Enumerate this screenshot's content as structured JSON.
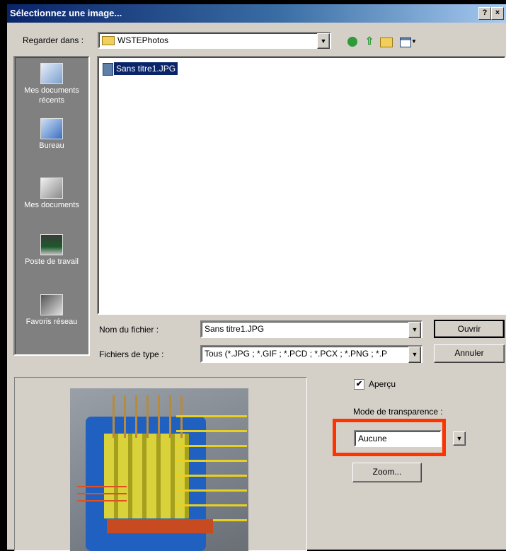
{
  "window": {
    "title": "Sélectionnez une image...",
    "help_label": "?",
    "close_label": "×"
  },
  "lookin": {
    "label": "Regarder dans :",
    "value": "WSTEPhotos"
  },
  "toolbar": {
    "back_icon": "green-arrow-icon",
    "up_icon": "up-folder-icon",
    "new_folder_icon": "new-folder-icon",
    "view_icon": "view-menu-icon"
  },
  "places": [
    {
      "label": "Mes documents récents",
      "icon": "recent-docs-icon"
    },
    {
      "label": "Bureau",
      "icon": "desktop-icon"
    },
    {
      "label": "Mes documents",
      "icon": "my-documents-icon"
    },
    {
      "label": "Poste de travail",
      "icon": "computer-icon"
    },
    {
      "label": "Favoris réseau",
      "icon": "network-icon"
    }
  ],
  "files": [
    {
      "name": "Sans titre1.JPG",
      "selected": true
    }
  ],
  "filename": {
    "label": "Nom du fichier :",
    "value": "Sans titre1.JPG"
  },
  "filetype": {
    "label": "Fichiers de type :",
    "value": "Tous (*.JPG ; *.GIF ; *.PCD ; *.PCX ; *.PNG ; *.P"
  },
  "buttons": {
    "open": "Ouvrir",
    "cancel": "Annuler",
    "zoom": "Zoom..."
  },
  "preview": {
    "checkbox_label": "Aperçu",
    "checked": true,
    "checkmark": "✔"
  },
  "transparency": {
    "label": "Mode de transparence :",
    "value": "Aucune"
  },
  "colors": {
    "highlight": "#ff3300",
    "selection": "#0a246a",
    "dialog_bg": "#d4d0c8"
  }
}
